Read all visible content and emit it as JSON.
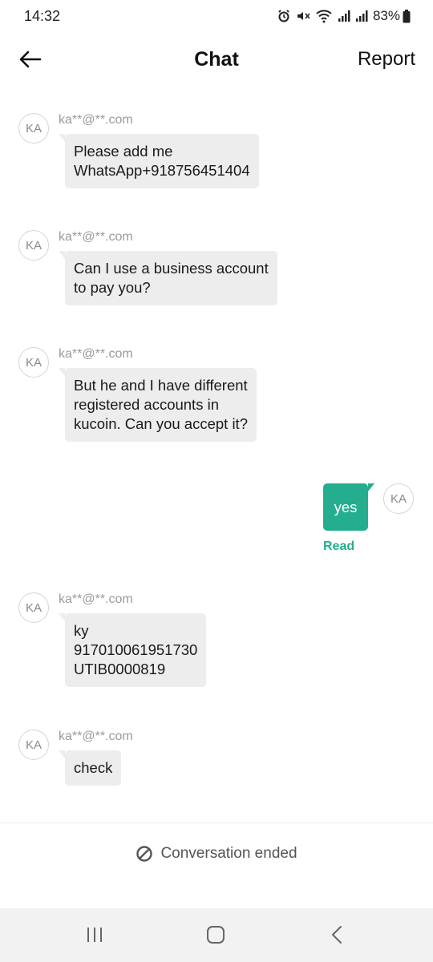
{
  "status_bar": {
    "time": "14:32",
    "battery": "83%",
    "icons": [
      "alarm-icon",
      "mute-icon",
      "wifi-icon",
      "signal-icon",
      "signal-icon",
      "battery-icon"
    ]
  },
  "header": {
    "title": "Chat",
    "report_label": "Report",
    "back_icon": "back-arrow-icon"
  },
  "messages": [
    {
      "avatar": "KA",
      "sender": "ka**@**.com",
      "text": "Please add me\nWhatsApp+918756451404"
    },
    {
      "avatar": "KA",
      "sender": "ka**@**.com",
      "text": "Can I use a business account\nto pay you?"
    },
    {
      "avatar": "KA",
      "sender": "ka**@**.com",
      "text": "But he and I have different\nregistered accounts in\nkucoin. Can you accept it?"
    },
    {
      "avatar": "KA",
      "text": "yes",
      "status": "Read",
      "outgoing": true
    },
    {
      "avatar": "KA",
      "sender": "ka**@**.com",
      "text": "ky\n917010061951730\nUTIB0000819"
    },
    {
      "avatar": "KA",
      "sender": "ka**@**.com",
      "text": "check"
    }
  ],
  "footer": {
    "ended_label": "Conversation ended",
    "ended_icon": "prohibited-icon"
  },
  "nav_bar": {
    "icons": [
      "recent-apps-icon",
      "home-icon",
      "back-icon"
    ]
  },
  "colors": {
    "accent": "#24ae8f",
    "incoming_bubble": "#ededed",
    "navbar_bg": "#f2f2f2"
  }
}
